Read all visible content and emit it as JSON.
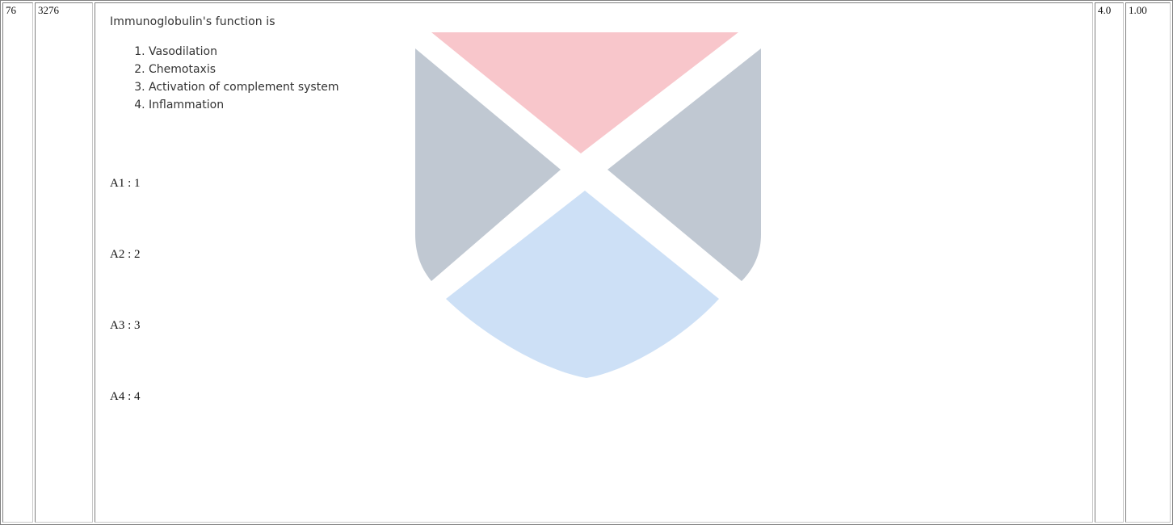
{
  "row": {
    "number": "76",
    "question_id": "3276",
    "marks": "4.0",
    "negative": "1.00"
  },
  "question": {
    "text": "Immunoglobulin's function is",
    "options": [
      "Vasodilation",
      "Chemotaxis",
      "Activation of complement system",
      "Inflammation"
    ]
  },
  "answers": [
    "A1 : 1",
    "A2 : 2",
    "A3 : 3",
    "A4 : 4"
  ],
  "watermark": {
    "icon": "shield-logo-icon",
    "colors": {
      "top": "#f8c6cb",
      "sides": "#c0c8d2",
      "bottom": "#cde0f6"
    }
  }
}
